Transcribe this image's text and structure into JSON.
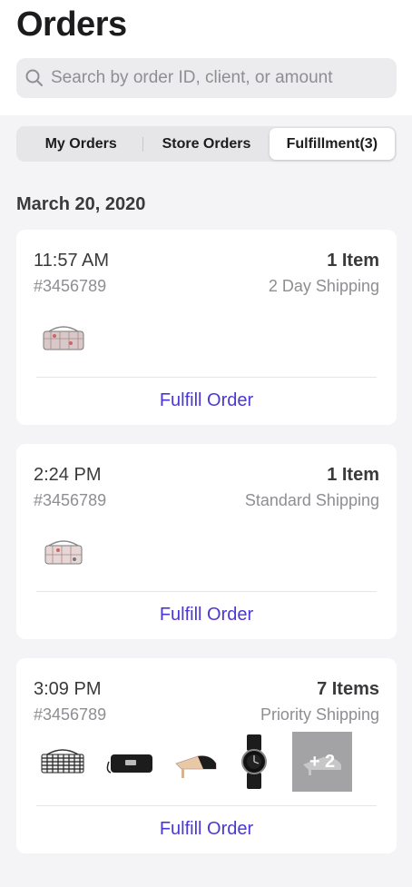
{
  "header": {
    "title": "Orders"
  },
  "search": {
    "placeholder": "Search by order ID, client, or amount"
  },
  "tabs": [
    {
      "label": "My Orders"
    },
    {
      "label": "Store Orders"
    },
    {
      "label": "Fulfillment(3)",
      "selected": true
    }
  ],
  "section": {
    "date": "March 20, 2020"
  },
  "orders": [
    {
      "time": "11:57 AM",
      "item_count": "1 Item",
      "order_id": "#3456789",
      "shipping": "2 Day Shipping",
      "action": "Fulfill Order",
      "items": [
        "quilted-flap-bag-icon"
      ]
    },
    {
      "time": "2:24 PM",
      "item_count": "1 Item",
      "order_id": "#3456789",
      "shipping": "Standard Shipping",
      "action": "Fulfill Order",
      "items": [
        "quilted-flap-bag-icon"
      ]
    },
    {
      "time": "3:09 PM",
      "item_count": "7 Items",
      "order_id": "#3456789",
      "shipping": "Priority Shipping",
      "action": "Fulfill Order",
      "items": [
        "tweed-bag-icon",
        "black-clutch-icon",
        "mule-shoe-icon",
        "watch-icon"
      ],
      "more_label": "+ 2"
    }
  ],
  "colors": {
    "accent": "#4b38d3",
    "background": "#f4f4f6",
    "card": "#ffffff"
  }
}
